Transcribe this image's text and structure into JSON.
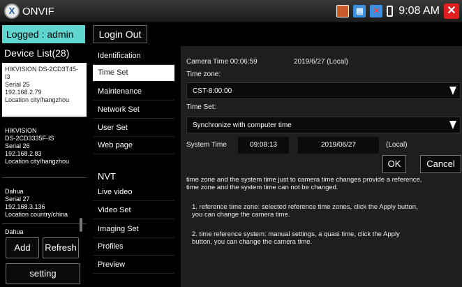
{
  "titlebar": {
    "title": "ONVIF",
    "logo_glyph": "X",
    "clock": "9:08 AM",
    "icons": [
      "sd-card-icon",
      "blue-square-icon",
      "no-network-icon",
      "battery-icon",
      "close-icon"
    ]
  },
  "session": {
    "logged_in": "Logged : admin",
    "login_out_label": "Login Out"
  },
  "device_list": {
    "header": "Device List(28)",
    "devices": [
      {
        "lines": [
          "HIKVISION DS-2CD3T45-",
          "I3",
          "Serial 25",
          "192.168.2.79",
          "Location city/hangzhou"
        ]
      },
      {
        "lines": [
          "HIKVISION",
          "DS-2CD3335F-IS",
          "Serial 26",
          "192.168.2.83",
          "Location city/hangzhou"
        ]
      },
      {
        "lines": [
          "Dahua",
          "Serial 27",
          "192.168.3.136",
          "Location country/china"
        ]
      },
      {
        "lines": [
          "Dahua"
        ]
      }
    ],
    "add_label": "Add",
    "refresh_label": "Refresh",
    "setting_label": "setting"
  },
  "menu": {
    "items": [
      "Identification",
      "Time Set",
      "Maintenance",
      "Network Set",
      "User Set",
      "Web page"
    ],
    "section": "NVT",
    "nvt_items": [
      "Live video",
      "Video Set",
      "Imaging Set",
      "Profiles",
      "Preview"
    ]
  },
  "timeset": {
    "camera_time": "Camera Time 00:06:59",
    "camera_date": "2019/6/27 (Local)",
    "timezone_label": "Time zone:",
    "timezone_value": "CST-8:00:00",
    "timeset_label": "Time Set:",
    "timeset_value": "Synchronize with computer time",
    "system_time_label": "System Time",
    "system_time_value": "09:08:13",
    "system_date_value": "2019/06/27",
    "local_label": "(Local)",
    "ok_label": "OK",
    "cancel_label": "Cancel",
    "description": [
      "time zone and the system time just to camera time changes provide a reference,",
      "time zone and the system time can not be changed."
    ],
    "note1": [
      "1. reference time zone: selected reference time zones, click the Apply button,",
      "you can change the camera time."
    ],
    "note2": [
      "2. time reference system: manual settings, a quasi time, click the Apply",
      "button, you can change the camera time."
    ]
  }
}
